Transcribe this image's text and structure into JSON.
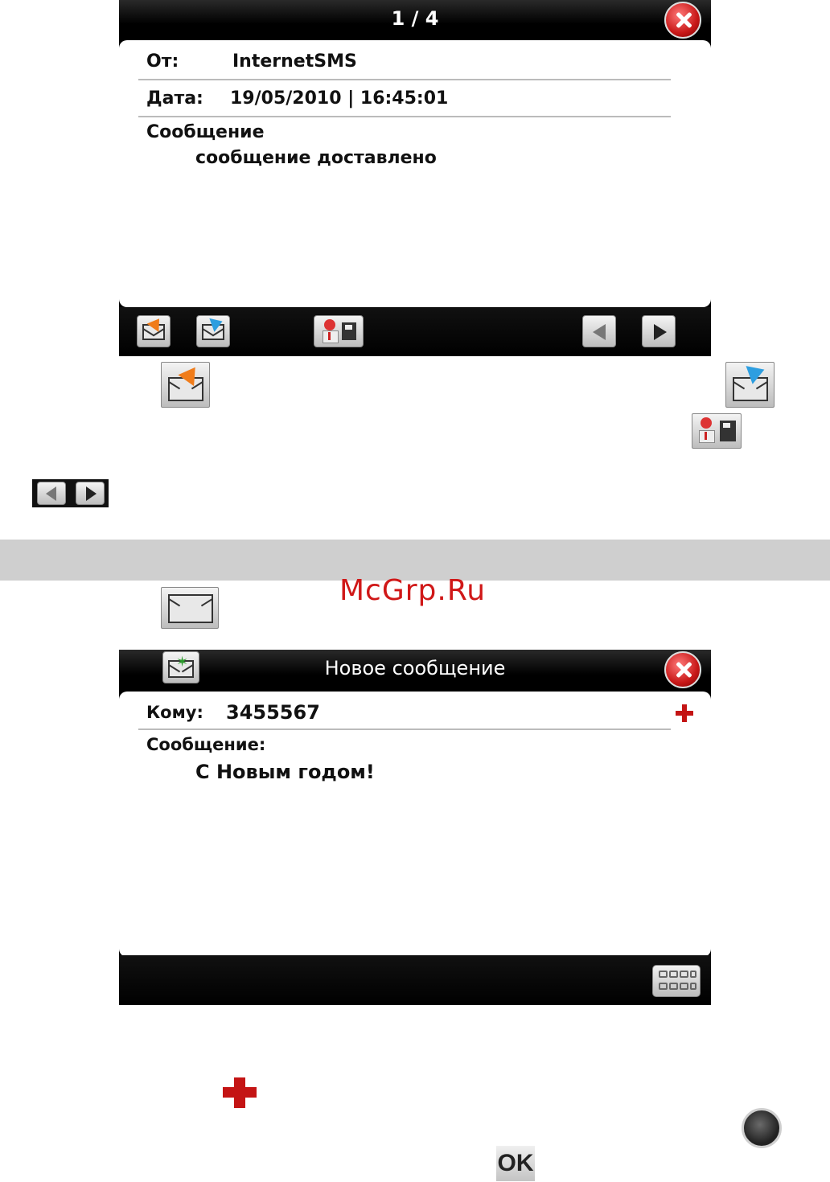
{
  "screen1": {
    "title": "1 / 4",
    "from_label": "От:",
    "from_value": "InternetSMS",
    "date_label": "Дата:",
    "date_value": "19/05/2010 | 16:45:01",
    "message_label": "Сообщение",
    "message_text": "сообщение доставлено",
    "toolbar_icons": [
      "reply-icon",
      "forward-icon",
      "save-contact-icon",
      "previous-icon",
      "next-icon"
    ]
  },
  "screen2": {
    "title": "Новое сообщение",
    "to_label": "Кому:",
    "to_value": "3455567",
    "message_label": "Сообщение:",
    "message_text": "С Новым годом!",
    "toolbar_icons": [
      "keyboard-icon"
    ]
  },
  "watermark": "McGrp.Ru",
  "ok_label": "OK",
  "colors": {
    "accent_red": "#c41414",
    "reply_orange": "#f07c1a",
    "forward_blue": "#2d9ee0",
    "band_gray": "#cfcfcf"
  }
}
